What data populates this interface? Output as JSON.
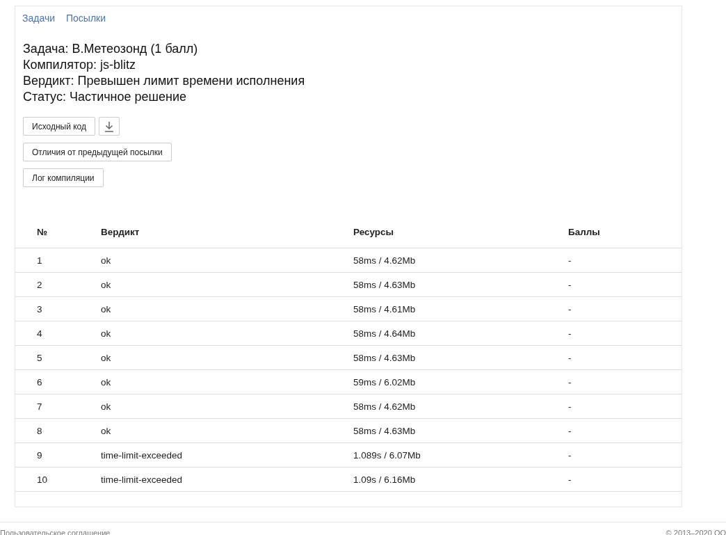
{
  "tabs": [
    {
      "label": "Задачи"
    },
    {
      "label": "Посылки"
    }
  ],
  "info": [
    "Задача: В.Метеозонд (1 балл)",
    "Компилятор: js-blitz",
    "Вердикт: Превышен лимит времени исполнения",
    "Статус: Частичное решение"
  ],
  "buttons": [
    {
      "label": "Исходный код",
      "download": true
    },
    {
      "label": "Отличия от предыдущей посылки",
      "download": false
    },
    {
      "label": "Лог компиляции",
      "download": false
    }
  ],
  "table": {
    "columns": [
      "№",
      "Вердикт",
      "Ресурсы",
      "Баллы"
    ],
    "rows": [
      [
        "1",
        "ok",
        "58ms / 4.62Mb",
        "-"
      ],
      [
        "2",
        "ok",
        "58ms / 4.63Mb",
        "-"
      ],
      [
        "3",
        "ok",
        "58ms / 4.61Mb",
        "-"
      ],
      [
        "4",
        "ok",
        "58ms / 4.64Mb",
        "-"
      ],
      [
        "5",
        "ok",
        "58ms / 4.63Mb",
        "-"
      ],
      [
        "6",
        "ok",
        "59ms / 6.02Mb",
        "-"
      ],
      [
        "7",
        "ok",
        "58ms / 4.62Mb",
        "-"
      ],
      [
        "8",
        "ok",
        "58ms / 4.63Mb",
        "-"
      ],
      [
        "9",
        "time-limit-exceeded",
        "1.089s / 6.07Mb",
        "-"
      ],
      [
        "10",
        "time-limit-exceeded",
        "1.09s / 6.16Mb",
        "-"
      ]
    ]
  },
  "footer": {
    "link": "Пользовательское соглашение",
    "copyright": "© 2013–2020 ОО"
  }
}
